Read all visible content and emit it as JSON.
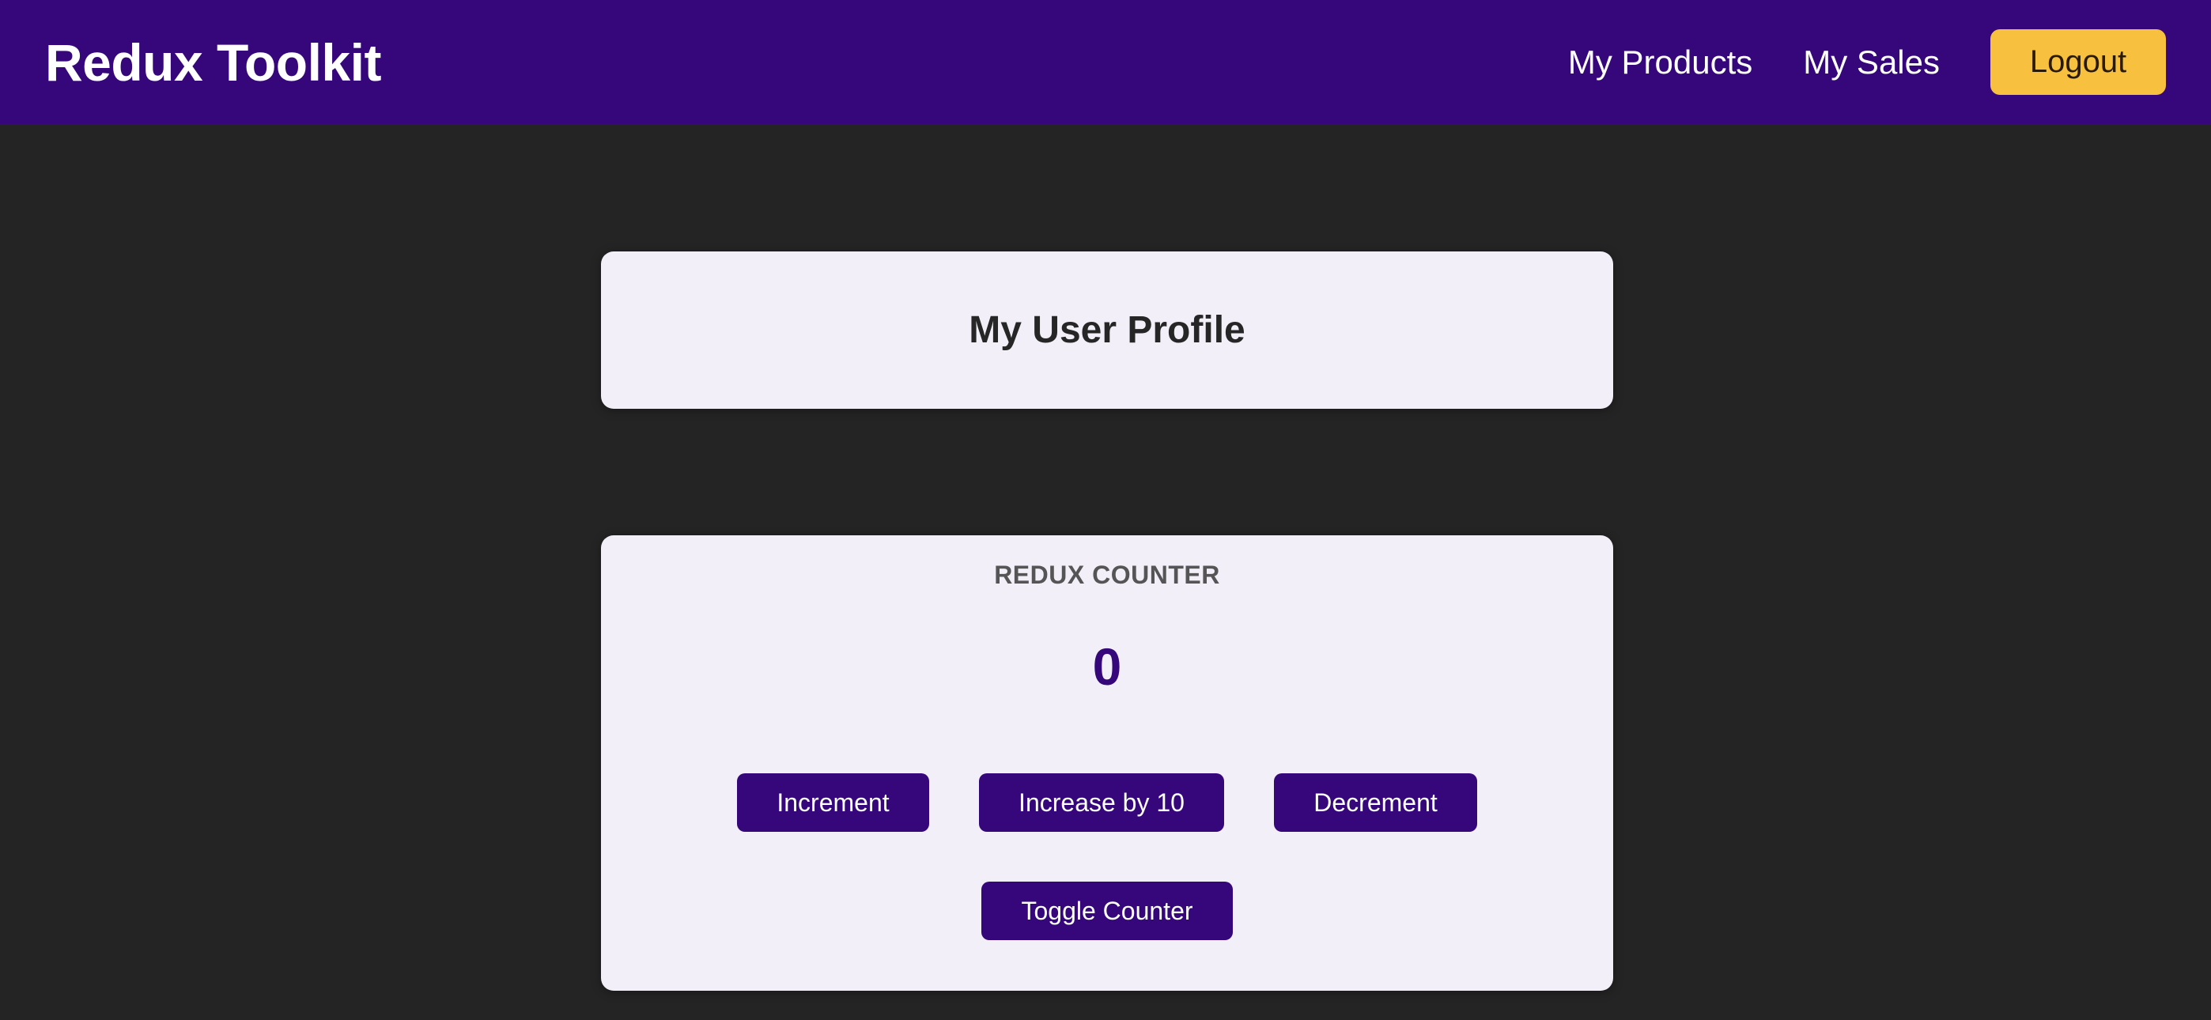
{
  "header": {
    "logo": "Redux Toolkit",
    "nav": {
      "products_label": "My Products",
      "sales_label": "My Sales",
      "logout_label": "Logout"
    },
    "colors": {
      "background": "#35077a",
      "logout_button": "#f7c13f"
    }
  },
  "profile": {
    "title": "My User Profile"
  },
  "counter": {
    "heading": "REDUX COUNTER",
    "value": "0",
    "buttons": {
      "increment": "Increment",
      "increase_by_10": "Increase by 10",
      "decrement": "Decrement",
      "toggle": "Toggle Counter"
    },
    "colors": {
      "accent": "#35077a",
      "card_background": "#f2eff8"
    }
  },
  "page": {
    "background": "#242424"
  }
}
